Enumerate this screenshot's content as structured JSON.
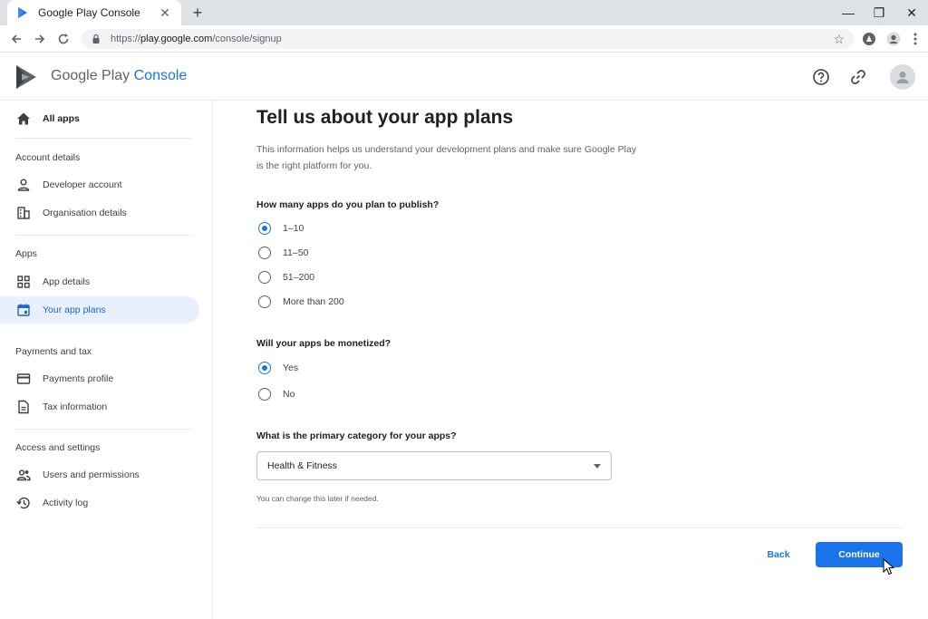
{
  "browser": {
    "tab_title": "Google Play Console",
    "new_tab_symbol": "+",
    "url_scheme": "https://",
    "url_host": "play.google.com",
    "url_path": "/console/signup"
  },
  "header": {
    "brand_google_play": "Google Play",
    "brand_console": "Console"
  },
  "sidebar": {
    "all_apps": "All apps",
    "section_account": "Account details",
    "developer_account": "Developer account",
    "organisation_details": "Organisation details",
    "section_apps": "Apps",
    "app_details": "App details",
    "your_app_plans": "Your app plans",
    "section_payments": "Payments and tax",
    "payments_profile": "Payments profile",
    "tax_information": "Tax information",
    "section_access": "Access and settings",
    "users_permissions": "Users and permissions",
    "activity_log": "Activity log"
  },
  "main": {
    "title": "Tell us about your app plans",
    "intro": "This information helps us understand your development plans and make sure Google Play is the right platform for you.",
    "q1": {
      "label": "How many apps do you plan to publish?",
      "options": [
        "1–10",
        "11–50",
        "51–200",
        "More than 200"
      ],
      "selected": "1–10"
    },
    "q2": {
      "label": "Will your apps be monetized?",
      "options": [
        "Yes",
        "No"
      ],
      "selected": "Yes"
    },
    "q3": {
      "label": "What is the primary category for your apps?",
      "value": "Health & Fitness",
      "helper": "You can change this later if needed."
    },
    "back_label": "Back",
    "continue_label": "Continue"
  },
  "colors": {
    "accent": "#1a73e8",
    "active_nav_bg": "#e8f0fe"
  }
}
